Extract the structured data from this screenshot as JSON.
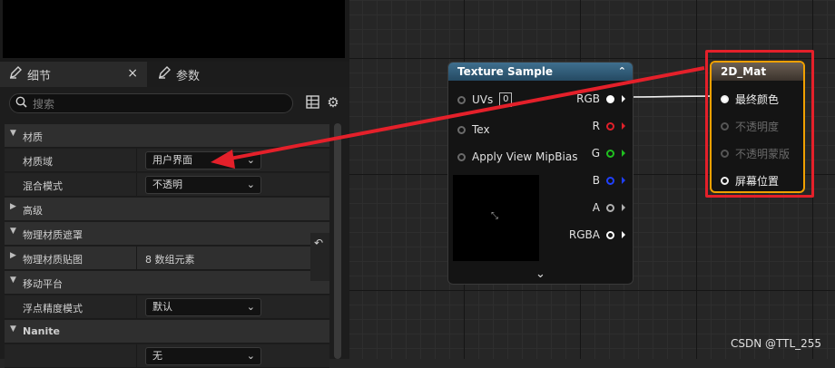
{
  "details_panel": {
    "tab_details": "细节",
    "tab_params": "参数",
    "search_placeholder": "搜索",
    "rows": [
      {
        "kind": "cat",
        "label": "材质",
        "expanded": true
      },
      {
        "kind": "prop",
        "label": "材质域",
        "value": "用户界面",
        "control": "combo"
      },
      {
        "kind": "prop",
        "label": "混合模式",
        "value": "不透明",
        "control": "combo"
      },
      {
        "kind": "subcat",
        "label": "高级",
        "expanded": false
      },
      {
        "kind": "cat",
        "label": "物理材质遮罩",
        "expanded": true
      },
      {
        "kind": "subcat",
        "label": "物理材质贴图",
        "value": "8 数组元素",
        "expanded": false
      },
      {
        "kind": "cat",
        "label": "移动平台",
        "expanded": true
      },
      {
        "kind": "prop",
        "label": "浮点精度模式",
        "value": "默认",
        "control": "combo"
      },
      {
        "kind": "cat",
        "label": "Nanite",
        "expanded": true
      },
      {
        "kind": "prop",
        "label": "",
        "value": "无",
        "control": "combo"
      }
    ]
  },
  "texture_node": {
    "title": "Texture Sample",
    "inputs": [
      "UVs",
      "Tex",
      "Apply View MipBias"
    ],
    "uv_value": "0",
    "outputs": [
      {
        "label": "RGB",
        "color": "#ffffff"
      },
      {
        "label": "R",
        "color": "#e0202a"
      },
      {
        "label": "G",
        "color": "#20c020"
      },
      {
        "label": "B",
        "color": "#2040ff"
      },
      {
        "label": "A",
        "color": "#b0b0b0"
      },
      {
        "label": "RGBA",
        "color": "#ffffff"
      }
    ]
  },
  "material_node": {
    "title": "2D_Mat",
    "pins": [
      {
        "label": "最终颜色",
        "enabled": true
      },
      {
        "label": "不透明度",
        "enabled": false
      },
      {
        "label": "不透明蒙版",
        "enabled": false
      },
      {
        "label": "屏幕位置",
        "enabled": true
      }
    ]
  },
  "watermark": "CSDN @TTL_255",
  "colors": {
    "annotation": "#e4202a",
    "selection": "#f0a000",
    "texture_header": "#3f6f8e"
  }
}
